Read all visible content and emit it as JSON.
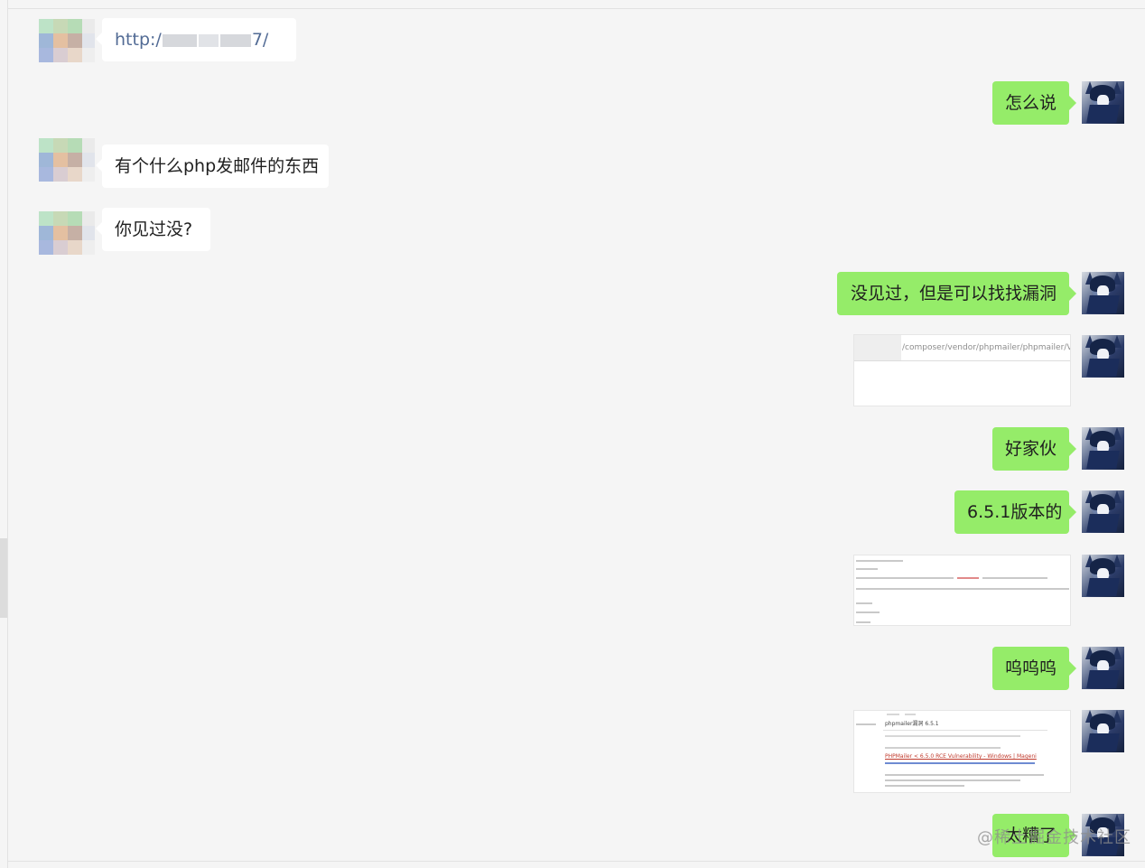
{
  "messages": {
    "received": [
      {
        "text_prefix": "http:/",
        "text_suffix": "7/"
      },
      {
        "text": "有个什么php发邮件的东西"
      },
      {
        "text": "你见过没?"
      }
    ],
    "sent": [
      {
        "text": "怎么说"
      },
      {
        "text": "没见过，但是可以找找漏洞"
      },
      {
        "text": "好家伙"
      },
      {
        "text": "6.5.1版本的"
      },
      {
        "text": "呜呜呜"
      },
      {
        "text": "太糟了"
      }
    ],
    "images": {
      "url_snippet": "/composer/vendor/phpmailer/phpmailer/VER",
      "search_snippet": "phpmailer漏洞 6.5.1",
      "search_result_title": "PHPMailer < 6.5.0 RCE Vulnerability - Windows | Mageni"
    }
  },
  "watermark": {
    "text": "@稀土掘金技术社区"
  },
  "colors": {
    "background": "#f5f5f5",
    "sent_bubble": "#95ec69",
    "received_bubble": "#ffffff",
    "link": "#526b95"
  }
}
